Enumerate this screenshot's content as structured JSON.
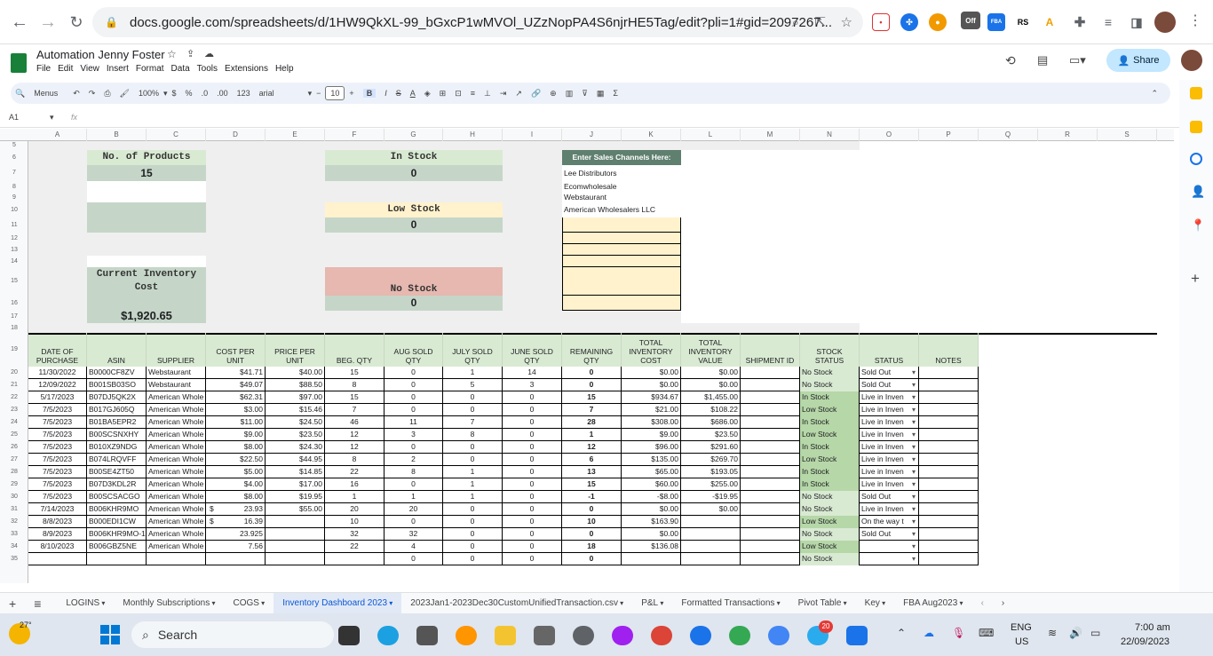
{
  "browser": {
    "url": "docs.google.com/spreadsheets/d/1HW9QkXL-99_bGxcP1wMVOl_UZzNopPA4S6njrHE5Tag/edit?pli=1#gid=2097267...",
    "ext_off": "Off"
  },
  "doc": {
    "title": "Automation Jenny Foster",
    "menus": [
      "File",
      "Edit",
      "View",
      "Insert",
      "Format",
      "Data",
      "Tools",
      "Extensions",
      "Help"
    ],
    "share": "Share"
  },
  "toolbar": {
    "search": "Menus",
    "zoom": "100%",
    "currency": "$",
    "percent": "%",
    "dec_less": ".0",
    "dec_more": ".00",
    "format123": "123",
    "font": "arial",
    "size": "10"
  },
  "formula": {
    "cellref": "A1",
    "fx": "fx"
  },
  "columns": [
    "A",
    "B",
    "C",
    "D",
    "E",
    "F",
    "G",
    "H",
    "I",
    "J",
    "K",
    "L",
    "M",
    "N",
    "O",
    "P",
    "Q",
    "R",
    "S"
  ],
  "rows": [
    "5",
    "6",
    "7",
    "8",
    "9",
    "10",
    "11",
    "12",
    "13",
    "14",
    "15",
    "16",
    "17",
    "18",
    "19",
    "20",
    "21",
    "22",
    "23",
    "24",
    "25",
    "26",
    "27",
    "28",
    "29",
    "30",
    "31",
    "32",
    "33",
    "34",
    "35"
  ],
  "dash": {
    "products_label": "No. of Products",
    "products_value": "15",
    "instock_label": "In Stock",
    "instock_value": "0",
    "lowstock_label": "Low Stock",
    "lowstock_value": "0",
    "nostock_label": "No Stock",
    "nostock_value": "0",
    "cost_label": "Current Inventory Cost",
    "cost_value": "$1,920.65",
    "channels_header": "Enter Sales Channels Here:",
    "channels": [
      "Lee Distributors",
      "Ecomwholesale",
      "Webstaurant",
      "American Wholesalers LLC"
    ]
  },
  "table": {
    "headers": [
      "DATE OF PURCHASE",
      "ASIN",
      "SUPPLIER",
      "COST PER UNIT",
      "PRICE PER UNIT",
      "BEG. QTY",
      "AUG SOLD QTY",
      "JULY SOLD QTY",
      "JUNE SOLD QTY",
      "REMAINING QTY",
      "TOTAL INVENTORY COST",
      "TOTAL INVENTORY VALUE",
      "SHIPMENT ID",
      "STOCK STATUS",
      "STATUS",
      "NOTES"
    ],
    "rows": [
      [
        "11/30/2022",
        "B0000CF8ZV",
        "Webstaurant",
        "$41.71",
        "$40.00",
        "15",
        "0",
        "1",
        "14",
        "0",
        "$0.00",
        "$0.00",
        "",
        "No Stock",
        "Sold Out",
        ""
      ],
      [
        "12/09/2022",
        "B001SB03SO",
        "Webstaurant",
        "$49.07",
        "$88.50",
        "8",
        "0",
        "5",
        "3",
        "0",
        "$0.00",
        "$0.00",
        "",
        "No Stock",
        "Sold Out",
        ""
      ],
      [
        "5/17/2023",
        "B07DJ5QK2X",
        "American Whole",
        "$62.31",
        "$97.00",
        "15",
        "0",
        "0",
        "0",
        "15",
        "$934.67",
        "$1,455.00",
        "",
        "In Stock",
        "Live in Inven",
        ""
      ],
      [
        "7/5/2023",
        "B017GJ605Q",
        "American Whole",
        "$3.00",
        "$15.46",
        "7",
        "0",
        "0",
        "0",
        "7",
        "$21.00",
        "$108.22",
        "",
        "Low Stock",
        "Live in Inven",
        ""
      ],
      [
        "7/5/2023",
        "B01BA5EPR2",
        "American Whole",
        "$11.00",
        "$24.50",
        "46",
        "11",
        "7",
        "0",
        "28",
        "$308.00",
        "$686.00",
        "",
        "In Stock",
        "Live in Inven",
        ""
      ],
      [
        "7/5/2023",
        "B00SCSNXHY",
        "American Whole",
        "$9.00",
        "$23.50",
        "12",
        "3",
        "8",
        "0",
        "1",
        "$9.00",
        "$23.50",
        "",
        "Low Stock",
        "Live in Inven",
        ""
      ],
      [
        "7/5/2023",
        "B010XZ9NDG",
        "American Whole",
        "$8.00",
        "$24.30",
        "12",
        "0",
        "0",
        "0",
        "12",
        "$96.00",
        "$291.60",
        "",
        "In Stock",
        "Live in Inven",
        ""
      ],
      [
        "7/5/2023",
        "B074LRQVFF",
        "American Whole",
        "$22.50",
        "$44.95",
        "8",
        "2",
        "0",
        "0",
        "6",
        "$135.00",
        "$269.70",
        "",
        "Low Stock",
        "Live in Inven",
        ""
      ],
      [
        "7/5/2023",
        "B00SE4ZT50",
        "American Whole",
        "$5.00",
        "$14.85",
        "22",
        "8",
        "1",
        "0",
        "13",
        "$65.00",
        "$193.05",
        "",
        "In Stock",
        "Live in Inven",
        ""
      ],
      [
        "7/5/2023",
        "B07D3KDL2R",
        "American Whole",
        "$4.00",
        "$17.00",
        "16",
        "0",
        "1",
        "0",
        "15",
        "$60.00",
        "$255.00",
        "",
        "In Stock",
        "Live in Inven",
        ""
      ],
      [
        "7/5/2023",
        "B00SCSACGO",
        "American Whole",
        "$8.00",
        "$19.95",
        "1",
        "1",
        "1",
        "0",
        "-1",
        "-$8.00",
        "-$19.95",
        "",
        "No Stock",
        "Sold Out",
        ""
      ],
      [
        "7/14/2023",
        "B006KHR9MO",
        "American Whole",
        "23.93",
        "$55.00",
        "20",
        "20",
        "0",
        "0",
        "0",
        "$0.00",
        "$0.00",
        "",
        "No Stock",
        "Live in Inven",
        ""
      ],
      [
        "8/8/2023",
        "B000EDI1CW",
        "American Whole",
        "16.39",
        "",
        "10",
        "0",
        "0",
        "0",
        "10",
        "$163.90",
        "",
        "",
        "Low Stock",
        "On the way t",
        ""
      ],
      [
        "8/9/2023",
        "B006KHR9MO-1",
        "American Whole",
        "23.925",
        "",
        "32",
        "32",
        "0",
        "0",
        "0",
        "$0.00",
        "",
        "",
        "No Stock",
        "Sold Out",
        ""
      ],
      [
        "8/10/2023",
        "B006GBZ5NE",
        "American Whole",
        "7.56",
        "",
        "22",
        "4",
        "0",
        "0",
        "18",
        "$136.08",
        "",
        "",
        "Low Stock",
        "",
        ""
      ],
      [
        "",
        "",
        "",
        "",
        "",
        "",
        "0",
        "0",
        "0",
        "0",
        "",
        "",
        "",
        "No Stock",
        "",
        ""
      ]
    ],
    "dollar_prefix_rows": [
      "31",
      "32"
    ]
  },
  "sheet_tabs": [
    "LOGINS",
    "Monthly Subscriptions",
    "COGS",
    "Inventory Dashboard 2023",
    "2023Jan1-2023Dec30CustomUnifiedTransaction.csv",
    "P&L",
    "Formatted Transactions",
    "Pivot Table",
    "Key",
    "FBA Aug2023"
  ],
  "taskbar": {
    "weather": "27°",
    "search": "Search",
    "badge": "20",
    "lang1": "ENG",
    "lang2": "US",
    "time": "7:00 am",
    "date": "22/09/2023"
  }
}
